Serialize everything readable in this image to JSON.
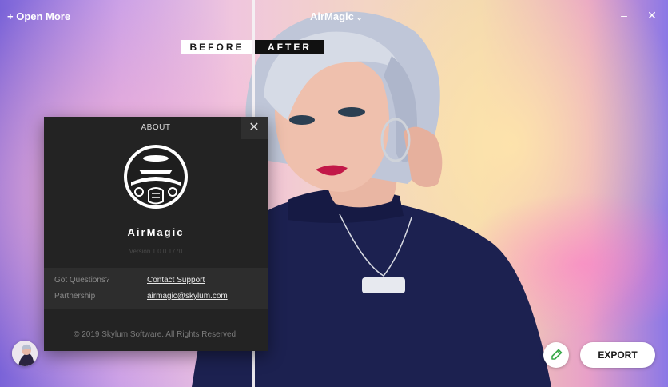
{
  "topbar": {
    "open_more": "+ Open More",
    "title": "AirMagic",
    "title_chevron": "⌄",
    "minimize": "–",
    "close": "✕"
  },
  "compare": {
    "before_label": "BEFORE",
    "after_label": "AFTER"
  },
  "about": {
    "title": "ABOUT",
    "close": "✕",
    "app_name": "AirMagic",
    "version": "Version 1.0.0.1770",
    "rows": [
      {
        "label": "Got Questions?",
        "link": "Contact Support"
      },
      {
        "label": "Partnership",
        "link": "airmagic@skylum.com"
      }
    ],
    "copyright": "© 2019 Skylum Software. All Rights Reserved."
  },
  "bottom": {
    "export_label": "EXPORT"
  },
  "colors": {
    "dialog_bg": "#232323",
    "dialog_panel": "#2d2d2d",
    "accent_edit_icon": "#3aa84a"
  },
  "icons": {
    "avatar": "profile-avatar-icon",
    "edit": "pencil-icon"
  }
}
